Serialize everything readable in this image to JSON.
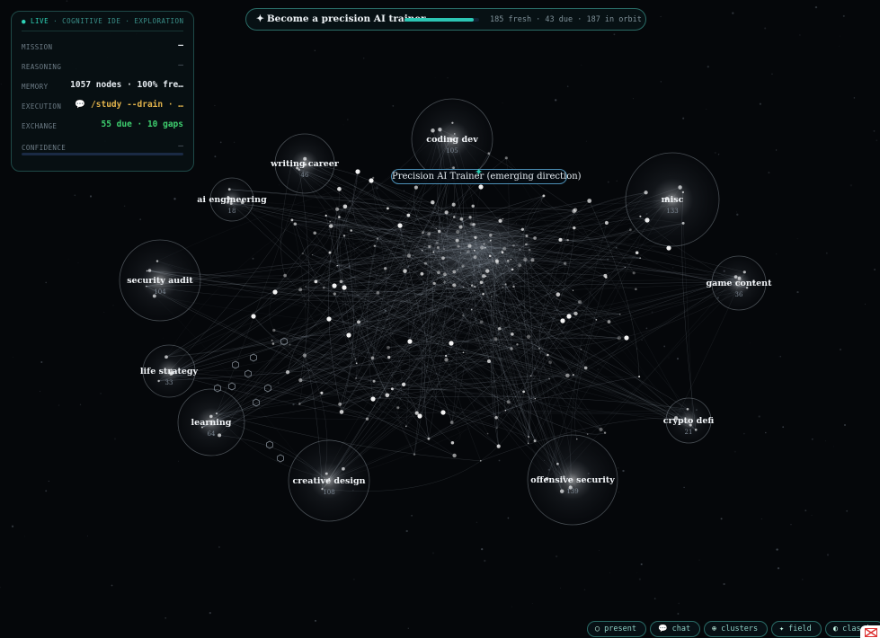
{
  "panel": {
    "live": "LIVE",
    "breadcrumb": "· COGNITIVE IDE · EXPLORATION",
    "rows": [
      {
        "key": "MISSION",
        "value": "—"
      },
      {
        "key": "REASONING",
        "value": "—"
      },
      {
        "key": "MEMORY",
        "value": "1057 nodes · 100% fre…"
      },
      {
        "key": "EXECUTION",
        "value": "/study --drain · …"
      },
      {
        "key": "EXCHANGE",
        "value": "55 due · 10 gaps"
      },
      {
        "key": "CONFIDENCE",
        "value": "—"
      }
    ]
  },
  "goal": {
    "title": "Become a precision AI trainer",
    "progress": 0.93,
    "stats": "185 fresh · 43 due · 187 in orbit",
    "accent": "#2cc6b4"
  },
  "emerging": {
    "label": "Precision AI Trainer (emerging direction)",
    "icon": "sparkle-icon"
  },
  "clusters": [
    {
      "name": "coding dev",
      "count": "105"
    },
    {
      "name": "writing career",
      "count": "46"
    },
    {
      "name": "ai engineering",
      "count": "18"
    },
    {
      "name": "misc",
      "count": "133"
    },
    {
      "name": "security audit",
      "count": "104"
    },
    {
      "name": "game content",
      "count": "36"
    },
    {
      "name": "life strategy",
      "count": "33"
    },
    {
      "name": "learning",
      "count": "64"
    },
    {
      "name": "crypto defi",
      "count": "21"
    },
    {
      "name": "creative design",
      "count": "108"
    },
    {
      "name": "offensive security",
      "count": "139"
    }
  ],
  "toolbar": [
    {
      "icon": "present-icon",
      "glyph": "◯",
      "label": "present"
    },
    {
      "icon": "chat-icon",
      "glyph": "💬",
      "label": "chat"
    },
    {
      "icon": "clusters-icon",
      "glyph": "⊕",
      "label": "clusters"
    },
    {
      "icon": "field-icon",
      "glyph": "✦",
      "label": "field"
    },
    {
      "icon": "classic-icon",
      "glyph": "◐",
      "label": "classic"
    }
  ]
}
